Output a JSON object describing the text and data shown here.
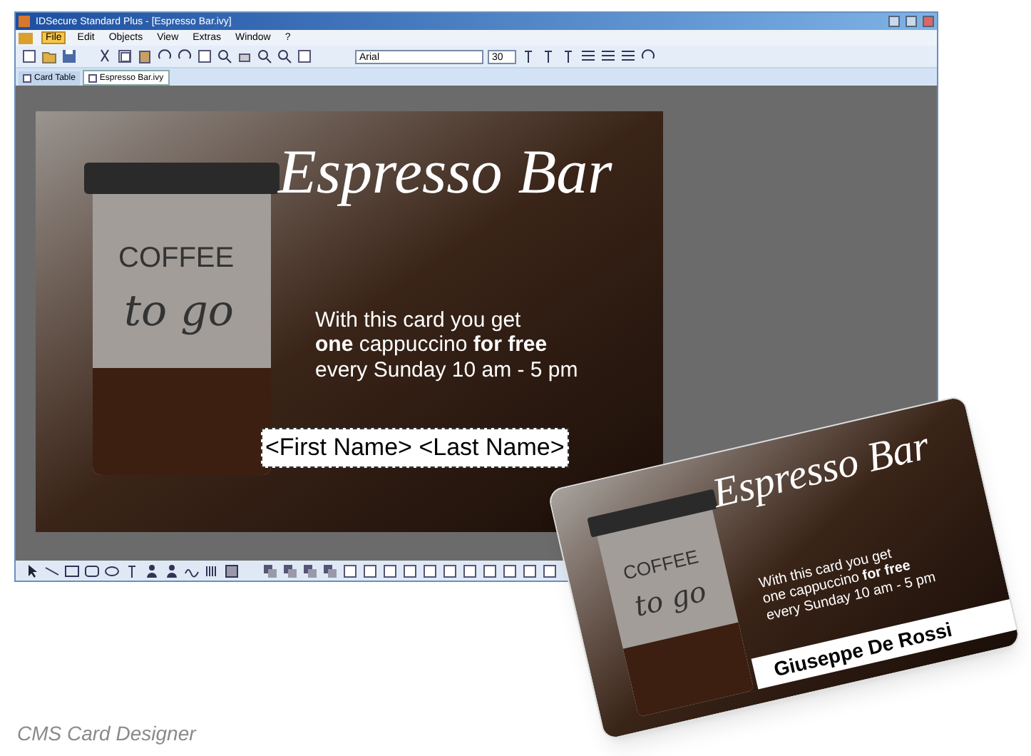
{
  "window": {
    "title": "IDSecure Standard Plus - [Espresso Bar.ivy]"
  },
  "menu": [
    {
      "label": "File",
      "selected": true
    },
    {
      "label": "Edit",
      "selected": false
    },
    {
      "label": "Objects",
      "selected": false
    },
    {
      "label": "View",
      "selected": false
    },
    {
      "label": "Extras",
      "selected": false
    },
    {
      "label": "Window",
      "selected": false
    },
    {
      "label": "?",
      "selected": false
    }
  ],
  "toolbar": {
    "font": "Arial",
    "size": "30"
  },
  "tabs": [
    {
      "label": "Card Table",
      "selected": false
    },
    {
      "label": "Espresso Bar.ivy",
      "selected": true
    }
  ],
  "card": {
    "title": "Espresso Bar",
    "cup_text": "COFFEE",
    "cup_script": "to go",
    "lines": [
      {
        "text": "With this card you get",
        "bold": false
      },
      {
        "text": "**one** cappuccino **for free**",
        "bold": false
      },
      {
        "text": "every Sunday 10 am - 5 pm",
        "bold": false
      }
    ],
    "name_field": {
      "value": "<First Name> <Last Name>",
      "selected": true
    }
  },
  "printed_card": {
    "title": "Espresso Bar",
    "cup_text": "COFFEE",
    "cup_script": "to go",
    "lines": [
      {
        "text": "With this card you get",
        "bold": false
      },
      {
        "text": "one cappuccino **for free**",
        "bold": false
      },
      {
        "text": "every Sunday 10 am - 5 pm",
        "bold": false
      }
    ],
    "name": "Giuseppe De Rossi"
  },
  "caption": "CMS Card Designer"
}
